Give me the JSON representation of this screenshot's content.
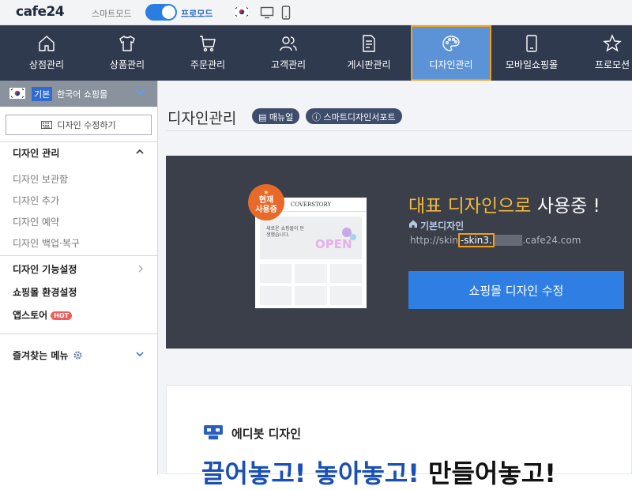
{
  "topbar": {
    "logo": "cafe24",
    "smart_mode_label": "스마트모드",
    "pro_mode_label": "프로모드",
    "pro_mode_on": true
  },
  "nav": {
    "items": [
      {
        "label": "상점관리",
        "icon": "home-icon"
      },
      {
        "label": "상품관리",
        "icon": "shirt-icon"
      },
      {
        "label": "주문관리",
        "icon": "cart-icon"
      },
      {
        "label": "고객관리",
        "icon": "users-icon"
      },
      {
        "label": "게시판관리",
        "icon": "document-icon"
      },
      {
        "label": "디자인관리",
        "icon": "palette-icon",
        "active": true
      },
      {
        "label": "모바일쇼핑몰",
        "icon": "mobile-icon"
      },
      {
        "label": "프로모션",
        "icon": "star-icon"
      }
    ],
    "active_color": "#5b93d6",
    "highlight_color": "#f0a01c"
  },
  "sidebar": {
    "shop_badge": "기본",
    "shop_name": "한국어 쇼핑몰",
    "edit_button": "디자인 수정하기",
    "design_section": {
      "title": "디자인 관리",
      "items": [
        "디자인 보관함",
        "디자인 추가",
        "디자인 예약",
        "디자인 백업·복구"
      ]
    },
    "design_features": "디자인 기능설정",
    "shop_env": "쇼핑몰 환경설정",
    "appstore": "앱스토어",
    "hot_badge": "HOT",
    "favorites": "즐겨찾는 메뉴"
  },
  "main": {
    "page_title": "디자인관리",
    "manual_btn": "매뉴얼",
    "support_btn": "스마트디자인서포트",
    "hero": {
      "badge_line1": "현재",
      "badge_line2": "사용중",
      "preview_brand": "COVERSTORY",
      "preview_text": "새로운 쇼핑몰이 탄생했습니다.",
      "title_highlight": "대표 디자인으로",
      "title_rest": " 사용중 !",
      "design_name": "기본디자인",
      "url_prefix": "http://skin",
      "url_boxed": "-skin3.",
      "url_blurred": "xxxxx",
      "url_suffix": ".cafe24.com",
      "edit_button": "쇼핑몰 디자인 수정"
    },
    "promo": {
      "title": "에디봇 디자인",
      "headline_blue1": "끌어놓고!",
      "headline_blue2": "놓아놓고!",
      "headline_dark": "만들어놓고!"
    }
  }
}
